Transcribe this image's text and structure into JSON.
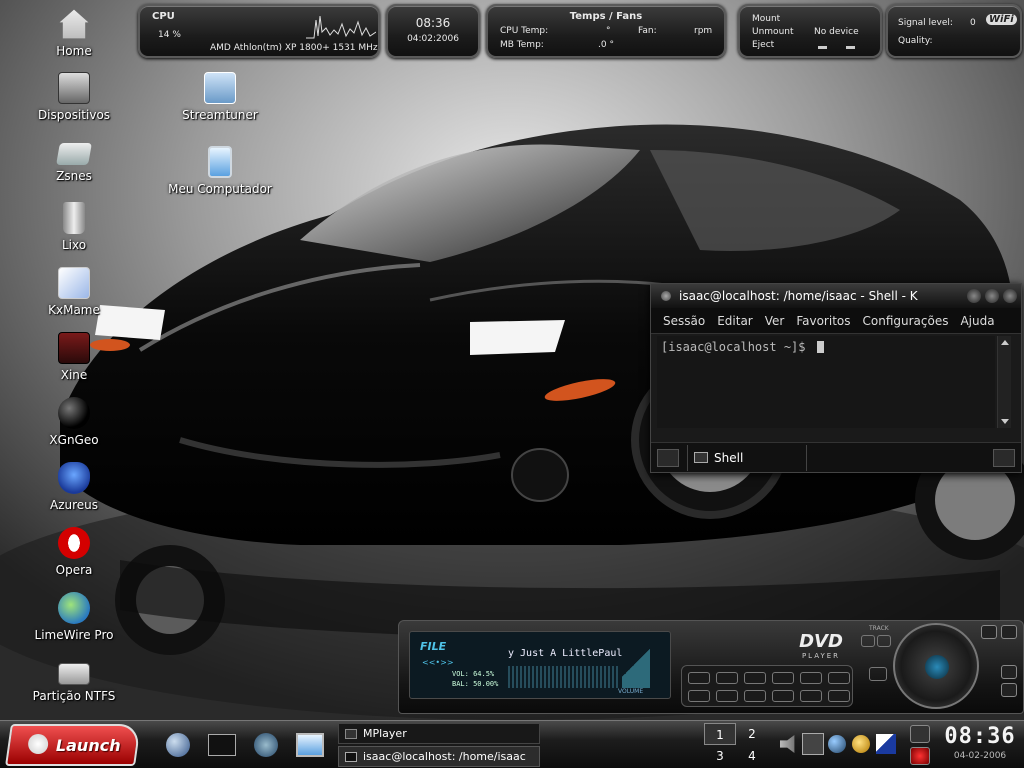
{
  "widgets": {
    "cpu": {
      "title": "CPU",
      "percent": "14 %",
      "model": "AMD Athlon(tm) XP 1800+ 1531 MHz"
    },
    "clock": {
      "time": "08:36",
      "date": "04:02:2006"
    },
    "temps": {
      "title": "Temps / Fans",
      "cpu_temp_label": "CPU Temp:",
      "cpu_temp_value": "°",
      "fan_label": "Fan:",
      "fan_value": "rpm",
      "mb_temp_label": "MB Temp:",
      "mb_temp_value": ".0 °"
    },
    "mount": {
      "mount": "Mount",
      "unmount": "Unmount",
      "eject": "Eject",
      "device": "No device"
    },
    "wifi": {
      "signal_label": "Signal level:",
      "signal_value": "0",
      "quality_label": "Quality:",
      "logo": "WiFi"
    }
  },
  "desktop": {
    "col1": [
      {
        "label": "Home",
        "icon": "home-icon"
      },
      {
        "label": "Dispositivos",
        "icon": "devices-icon"
      },
      {
        "label": "Zsnes",
        "icon": "zsnes-icon"
      },
      {
        "label": "Lixo",
        "icon": "trash-icon"
      },
      {
        "label": "KxMame",
        "icon": "kxmame-icon"
      },
      {
        "label": "Xine",
        "icon": "xine-icon"
      },
      {
        "label": "XGnGeo",
        "icon": "xgngeo-icon"
      },
      {
        "label": "Azureus",
        "icon": "azureus-icon"
      },
      {
        "label": "Opera",
        "icon": "opera-icon"
      },
      {
        "label": "LimeWire Pro",
        "icon": "limewire-icon"
      },
      {
        "label": "Partição NTFS",
        "icon": "ntfs-drive-icon"
      }
    ],
    "col2": [
      {
        "label": "Streamtuner",
        "icon": "streamtuner-icon"
      },
      {
        "label": "Meu Computador",
        "icon": "my-computer-icon"
      }
    ]
  },
  "konsole": {
    "title": "isaac@localhost: /home/isaac - Shell - K",
    "menu": [
      "Sessão",
      "Editar",
      "Ver",
      "Favoritos",
      "Configurações",
      "Ajuda"
    ],
    "prompt": "[isaac@localhost ~]$",
    "tab_label": "Shell"
  },
  "mplayer": {
    "file_label": "FILE",
    "song": "y Just A LittlePaul",
    "vol": "VOL: 64.5%",
    "bal": "BAL: 50.00%",
    "volume_label": "VOLUME",
    "dvd_label": "DVD",
    "player_label": "PLAYER",
    "track_label": "TRACK"
  },
  "taskbar": {
    "launch_label": "Launch",
    "tasks": [
      {
        "label": "MPlayer"
      },
      {
        "label": "isaac@localhost: /home/isaac"
      }
    ],
    "pager": [
      "1",
      "2",
      "3",
      "4"
    ],
    "clock_time": "08:36",
    "clock_date": "04-02-2006"
  }
}
